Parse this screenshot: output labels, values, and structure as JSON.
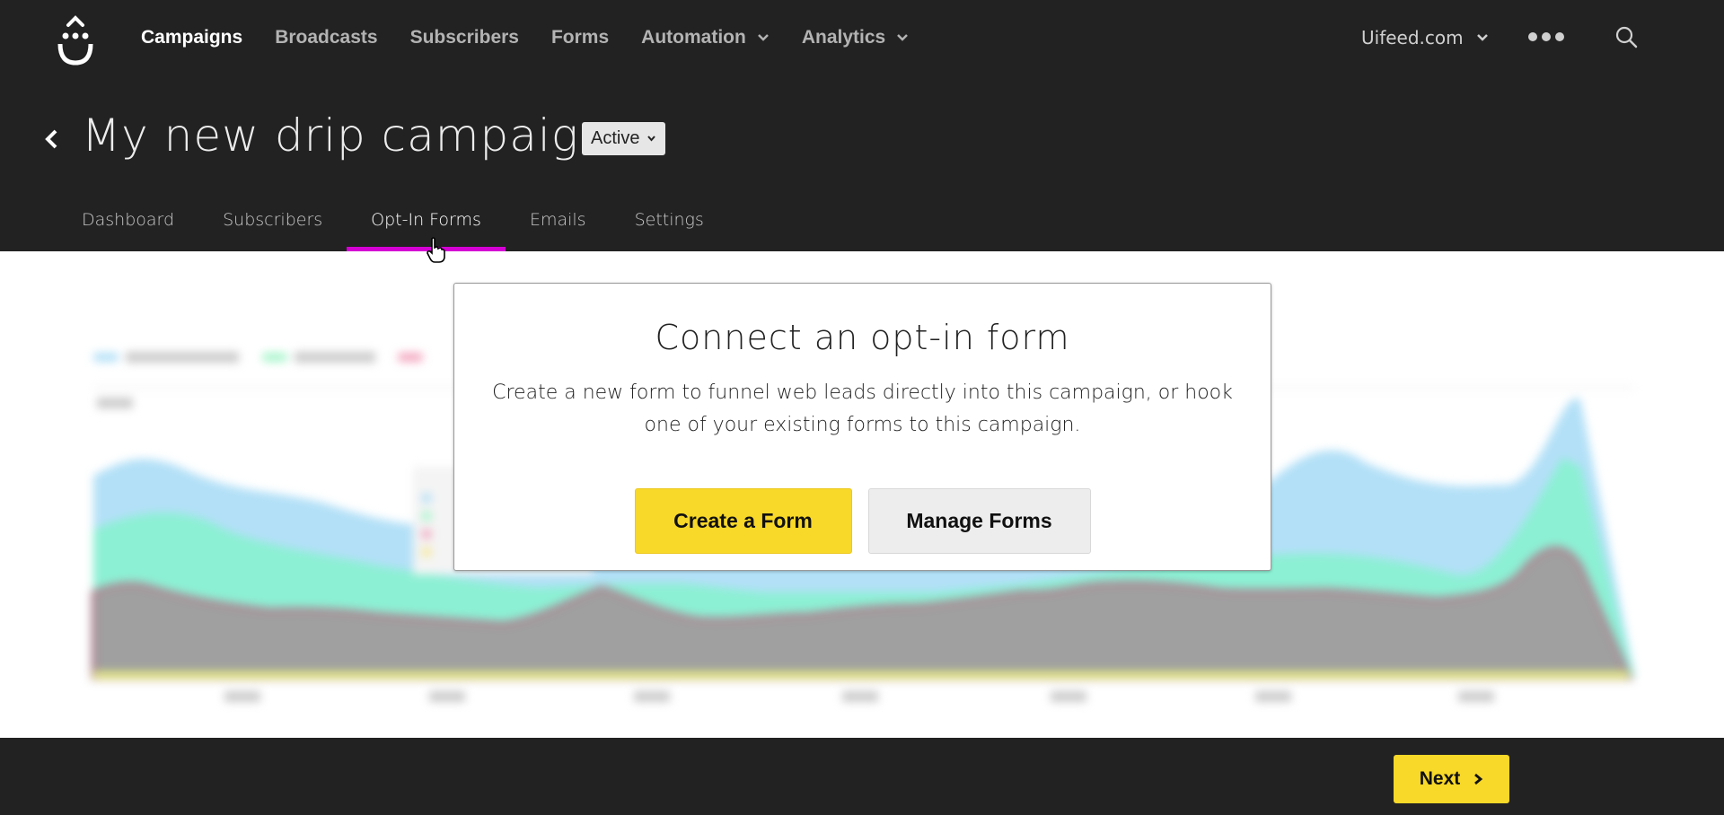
{
  "brand": {
    "logo": "smiley-drop-logo",
    "accent_color": "#f8d828",
    "tab_highlight_color": "#d400d4"
  },
  "nav": {
    "items": [
      {
        "label": "Campaigns",
        "active": true,
        "dropdown": false
      },
      {
        "label": "Broadcasts",
        "active": false,
        "dropdown": false
      },
      {
        "label": "Subscribers",
        "active": false,
        "dropdown": false
      },
      {
        "label": "Forms",
        "active": false,
        "dropdown": false
      },
      {
        "label": "Automation",
        "active": false,
        "dropdown": true
      },
      {
        "label": "Analytics",
        "active": false,
        "dropdown": true
      }
    ],
    "account_label": "Uifeed.com",
    "more_icon": "more-dots-icon",
    "search_icon": "search-icon"
  },
  "campaign": {
    "title": "My new drip campaign",
    "status": "Active"
  },
  "tabs": [
    {
      "label": "Dashboard",
      "active": false
    },
    {
      "label": "Subscribers",
      "active": false
    },
    {
      "label": "Opt-In Forms",
      "active": true
    },
    {
      "label": "Emails",
      "active": false
    },
    {
      "label": "Settings",
      "active": false
    }
  ],
  "modal": {
    "title": "Connect an opt-in form",
    "text": "Create a new form to funnel web leads directly into this campaign, or hook one of your existing forms to this campaign.",
    "primary_button": "Create a Form",
    "secondary_button": "Manage Forms"
  },
  "background_chart": {
    "blurred": true,
    "type": "area",
    "series_colors": [
      "#b3e0f7",
      "#8cf0d4",
      "#f0a0b8",
      "#a0a0a0",
      "#e8f080"
    ]
  },
  "footer": {
    "next_label": "Next"
  }
}
